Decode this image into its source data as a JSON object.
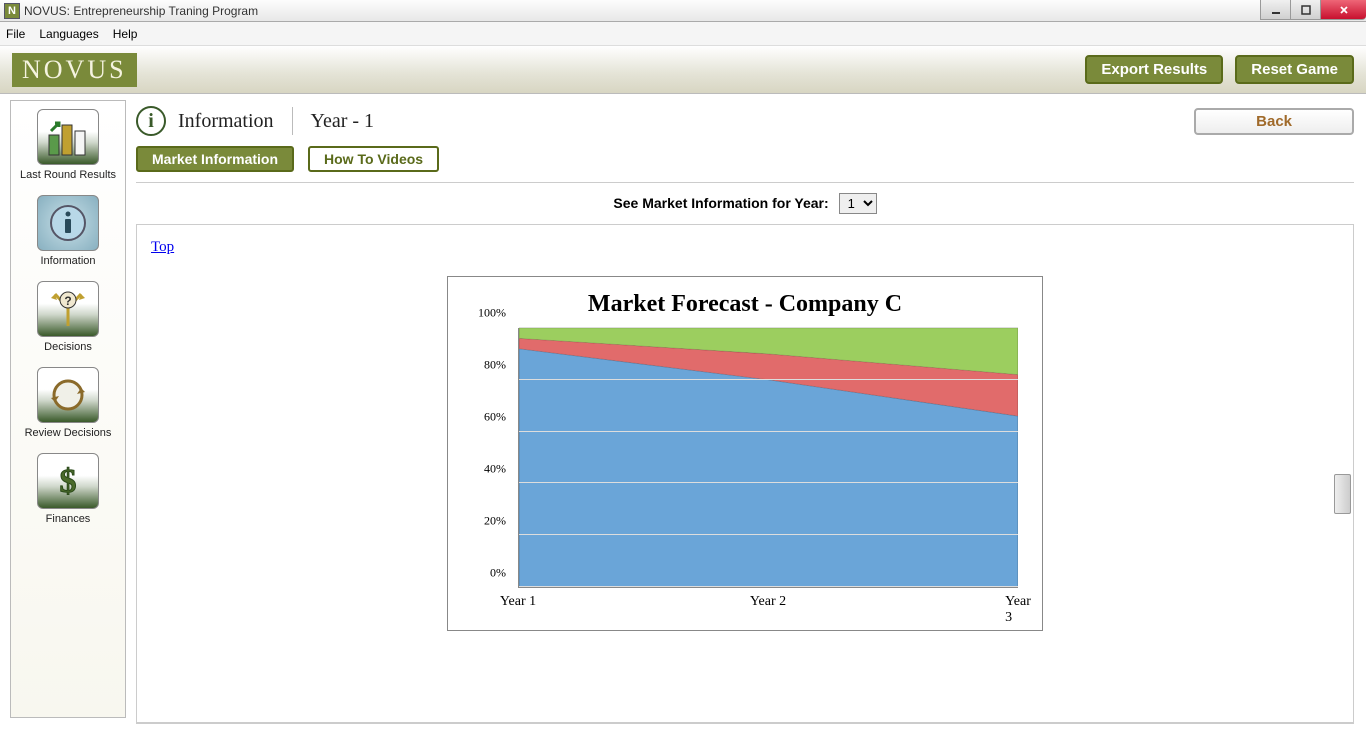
{
  "window": {
    "title": "NOVUS: Entrepreneurship Traning Program",
    "icon_letter": "N"
  },
  "menu": {
    "items": [
      "File",
      "Languages",
      "Help"
    ]
  },
  "header": {
    "logo": "NOVUS",
    "export_btn": "Export Results",
    "reset_btn": "Reset Game"
  },
  "sidebar": {
    "items": [
      {
        "label": "Last Round Results"
      },
      {
        "label": "Information"
      },
      {
        "label": "Decisions"
      },
      {
        "label": "Review Decisions"
      },
      {
        "label": "Finances"
      }
    ]
  },
  "page": {
    "section": "Information",
    "year_label": "Year - 1",
    "back": "Back",
    "tabs": {
      "active": "Market Information",
      "inactive": "How To Videos"
    },
    "year_selector_label": "See Market Information for Year:",
    "year_selector_value": "1",
    "top_link": "Top"
  },
  "chart_data": {
    "type": "area",
    "title": "Market Forecast - Company C",
    "categories": [
      "Year 1",
      "Year 2",
      "Year 3"
    ],
    "series": [
      {
        "name": "Blue",
        "color": "#6aa5d8",
        "values": [
          92,
          80,
          66
        ]
      },
      {
        "name": "Red",
        "color": "#e16b6b",
        "values": [
          4,
          10,
          16
        ]
      },
      {
        "name": "Green",
        "color": "#9cce5f",
        "values": [
          4,
          10,
          18
        ]
      }
    ],
    "ylim": [
      0,
      100
    ],
    "y_ticks": [
      "0%",
      "20%",
      "40%",
      "60%",
      "80%",
      "100%"
    ],
    "stacked": true
  }
}
